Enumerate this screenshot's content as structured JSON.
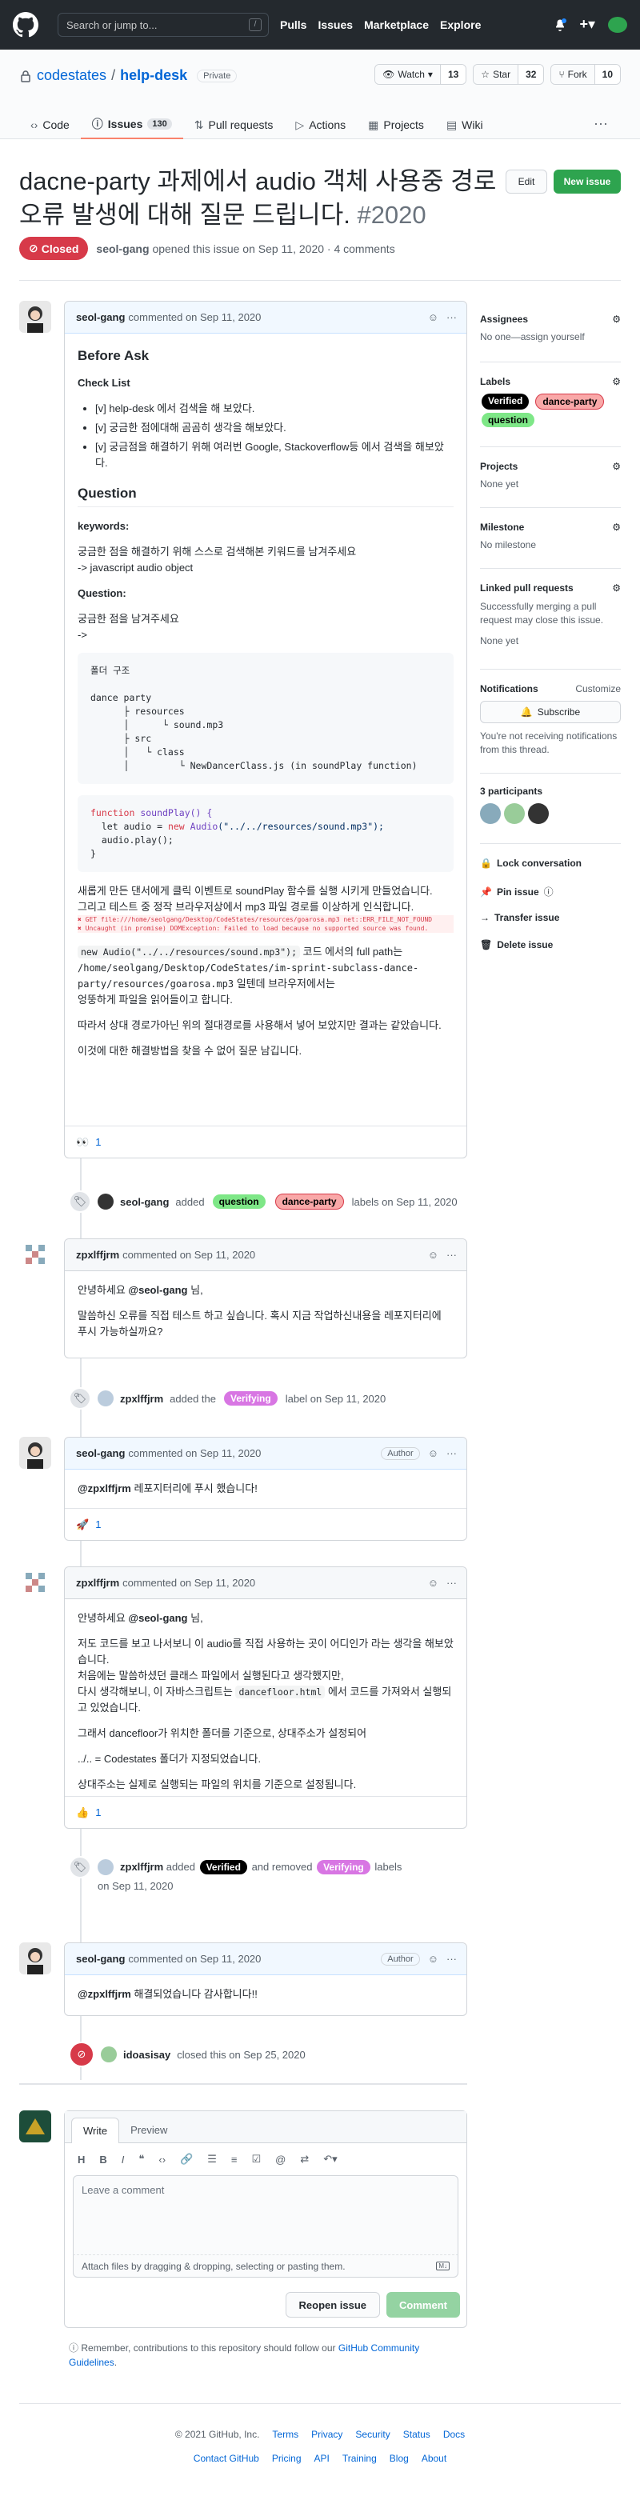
{
  "header": {
    "search_placeholder": "Search or jump to...",
    "slash": "/",
    "nav": [
      "Pulls",
      "Issues",
      "Marketplace",
      "Explore"
    ]
  },
  "repo": {
    "owner": "codestates",
    "sep": "/",
    "name": "help-desk",
    "visibility": "Private",
    "watch": {
      "label": "Watch",
      "count": "13"
    },
    "star": {
      "label": "Star",
      "count": "32"
    },
    "fork": {
      "label": "Fork",
      "count": "10"
    },
    "tabs": [
      {
        "label": "Code"
      },
      {
        "label": "Issues",
        "count": "130"
      },
      {
        "label": "Pull requests"
      },
      {
        "label": "Actions"
      },
      {
        "label": "Projects"
      },
      {
        "label": "Wiki"
      }
    ]
  },
  "issue": {
    "title": "dacne-party 과제에서 audio 객체 사용중 경로 오류 발생에 대해 질문 드립니다.",
    "number": "#2020",
    "edit": "Edit",
    "new_issue": "New issue",
    "status": "Closed",
    "author": "seol-gang",
    "meta": "opened this issue on Sep 11, 2020 · 4 comments"
  },
  "c1": {
    "author": "seol-gang",
    "meta": "commented on Sep 11, 2020",
    "before": "Before Ask",
    "check": "Check List",
    "items": [
      "[v] help-desk 에서 검색을 해 보았다.",
      "[v] 궁금한 점에대해 곰곰히 생각을 해보았다.",
      "[v] 궁금점을 해결하기 위해 여러번 Google, Stackoverflow등 에서 검색을 해보았다."
    ],
    "question": "Question",
    "kw_h": "keywords:",
    "kw1": "궁금한 점을 해결하기 위해 스스로 검색해본 키워드를 남겨주세요",
    "kw2": "-> javascript audio object",
    "q_h": "Question:",
    "q1": "궁금한 점을 남겨주세요",
    "q2": "->",
    "tree": "폴더 구조\n\ndance party\n      ├ resources\n      │      └ sound.mp3\n      ├ src\n      │   └ class\n      │         └ NewDancerClass.js (in soundPlay function)",
    "code_fn": "function",
    "code_name": " soundPlay() {",
    "code_l2a": "  let audio = ",
    "code_new": "new",
    "code_audio": " Audio",
    "code_str": "(\"../../resources/sound.mp3\");",
    "code_l3": "  audio.play();",
    "code_l4": "}",
    "p1": "새롭게 만든 댄서에게 클릭 이벤트로 soundPlay 함수를 실행 시키게 만들었습니다.",
    "p2": "그리고 테스트 중 정작 브라우저상에서 mp3 파일 경로를 이상하게 인식합니다.",
    "err1": "✖ GET file:///home/seolgang/Desktop/CodeStates/resources/goarosa.mp3 net::ERR_FILE_NOT_FOUND",
    "err2": "✖ Uncaught (in promise) DOMException: Failed to load because no supported source was found.",
    "p3a": "new Audio(\"../../resources/sound.mp3\");",
    "p3b": " 코드 에서의 full path는",
    "p3c": "/home/seolgang/Desktop/CodeStates/im-sprint-subclass-dance-party/resources/goarosa.mp3",
    "p3d": " 일텐데 브라우저에서는",
    "p3e": "엉뚱하게 파일을 읽어들이고 합니다.",
    "p4": "따라서 상대 경로가아닌 위의 절대경로를 사용해서 넣어 보았지만 결과는 같았습니다.",
    "p5": "이것에 대한 해결방법을 찾을 수 없어 질문 남깁니다.",
    "reaction": "👀",
    "rcount": "1"
  },
  "ev1": {
    "user": "seol-gang",
    "added": "added",
    "labels_on": "labels on Sep 11, 2020"
  },
  "labels": {
    "question": "question",
    "dance": "dance-party",
    "verifying": "Verifying",
    "verified": "Verified"
  },
  "c2": {
    "author": "zpxlffjrm",
    "meta": "commented on Sep 11, 2020",
    "l1a": "안녕하세요 ",
    "mention": "@seol-gang",
    "l1b": " 님,",
    "l2": "말씀하신 오류를 직접 테스트 하고 싶습니다. 혹시 지금 작업하신내용을 레포지터리에 푸시 가능하실까요?"
  },
  "ev2": {
    "user": "zpxlffjrm",
    "added": "added the",
    "label_on": "label on Sep 11, 2020"
  },
  "c3": {
    "author": "seol-gang",
    "meta": "commented on Sep 11, 2020",
    "badge": "Author",
    "mention": "@zpxlffjrm",
    "text": " 레포지터리에 푸시 했습니다!",
    "reaction": "🚀",
    "rcount": "1"
  },
  "c4": {
    "author": "zpxlffjrm",
    "meta": "commented on Sep 11, 2020",
    "l1a": "안녕하세요 ",
    "mention": "@seol-gang",
    "l1b": " 님,",
    "l2": "저도 코드를 보고 나서보니 이 audio를 직접 사용하는 곳이 어디인가 라는 생각을 해보았습니다.",
    "l3": "처음에는 말씀하셨던 클래스 파일에서 실행된다고 생각했지만,",
    "l4a": "다시 생각해보니, 이 자바스크립트는 ",
    "l4code": "dancefloor.html",
    "l4b": " 에서 코드를 가져와서 실행되고 있었습니다.",
    "l5": "그래서 dancefloor가 위치한 폴더를 기준으로, 상대주소가 설정되어",
    "l6": "../.. = Codestates 폴더가 지정되었습니다.",
    "l7": "상대주소는 실제로 실행되는 파일의 위치를 기준으로 설정됩니다.",
    "reaction": "👍",
    "rcount": "1"
  },
  "ev3": {
    "user": "zpxlffjrm",
    "added": "added",
    "removed": "and removed",
    "labels": "labels",
    "date": "on Sep 11, 2020"
  },
  "c5": {
    "author": "seol-gang",
    "meta": "commented on Sep 11, 2020",
    "badge": "Author",
    "mention": "@zpxlffjrm",
    "text": " 해결되었습니다 감사합니다!!"
  },
  "ev4": {
    "user": "idoasisay",
    "text": "closed this on Sep 25, 2020"
  },
  "editor": {
    "write": "Write",
    "preview": "Preview",
    "placeholder": "Leave a comment",
    "attach": "Attach files by dragging & dropping, selecting or pasting them.",
    "reopen": "Reopen issue",
    "comment": "Comment",
    "note": "Remember, contributions to this repository should follow our ",
    "guidelines": "GitHub Community Guidelines",
    "dot": "."
  },
  "sidebar": {
    "assignees": "Assignees",
    "assignees_val": "No one—assign yourself",
    "labels": "Labels",
    "projects": "Projects",
    "projects_val": "None yet",
    "milestone": "Milestone",
    "milestone_val": "No milestone",
    "linked": "Linked pull requests",
    "linked_desc": "Successfully merging a pull request may close this issue.",
    "linked_val": "None yet",
    "notif": "Notifications",
    "customize": "Customize",
    "subscribe": "Subscribe",
    "notif_desc": "You're not receiving notifications from this thread.",
    "participants": "3 participants",
    "lock": "Lock conversation",
    "pin": "Pin issue",
    "transfer": "Transfer issue",
    "delete": "Delete issue"
  },
  "footer": {
    "copy": "© 2021 GitHub, Inc.",
    "row1": [
      "Terms",
      "Privacy",
      "Security",
      "Status",
      "Docs"
    ],
    "row2": [
      "Contact GitHub",
      "Pricing",
      "API",
      "Training",
      "Blog",
      "About"
    ]
  },
  "colors": {
    "verified": "#000000",
    "dance": "#f9a8a8",
    "question": "#7ee787",
    "verifying": "#d876e3",
    "closed": "#d73a49",
    "green": "#2ea44f"
  }
}
